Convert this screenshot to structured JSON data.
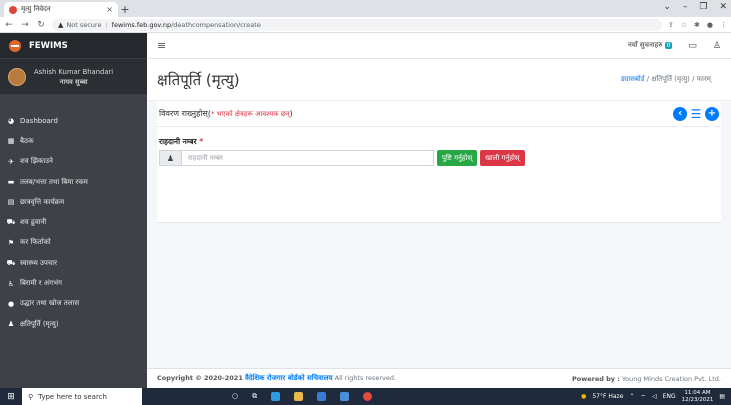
{
  "browser": {
    "tab_title": "मृत्यु निवेदन",
    "tab_close": "×",
    "new_tab": "+",
    "url_warning": "Not secure",
    "url_host": "fewims.feb.gov.np",
    "url_path": "/deathcompensation/create"
  },
  "sidebar": {
    "brand": "FEWIMS",
    "user_name": "Ashish Kumar Bhandari",
    "user_role": "नायव सुब्बा",
    "items": [
      {
        "icon": "dashboard-icon",
        "glyph": "◕",
        "label": "Dashboard"
      },
      {
        "icon": "calendar-icon",
        "glyph": "▦",
        "label": "बैठक"
      },
      {
        "icon": "plane-icon",
        "glyph": "✈",
        "label": "शव झिकाउने"
      },
      {
        "icon": "money-icon",
        "glyph": "▬",
        "label": "तलब/भत्ता तथा बिमा रकम"
      },
      {
        "icon": "document-icon",
        "glyph": "▤",
        "label": "छात्रवृत्ति कार्यक्रम"
      },
      {
        "icon": "truck-icon",
        "glyph": "⛟",
        "label": "शव ढुवानी"
      },
      {
        "icon": "flag-icon",
        "glyph": "⚑",
        "label": "कर फिर्ताको"
      },
      {
        "icon": "ambulance-icon",
        "glyph": "⛟",
        "label": "स्वास्थ्य उपचार"
      },
      {
        "icon": "wheelchair-icon",
        "glyph": "♿",
        "label": "बिरामी र अंगभंग"
      },
      {
        "icon": "location-icon",
        "glyph": "●",
        "label": "उद्धार तथा खोज तलास"
      },
      {
        "icon": "user-icon",
        "glyph": "♟",
        "label": "क्षतिपूर्ति (मृत्यु)"
      }
    ]
  },
  "topnav": {
    "notifications_label": "नयाँ सुचनाहरु",
    "notifications_count": "0"
  },
  "page": {
    "title": "क्षतिपूर्ति (मृत्यु)",
    "breadcrumb_home": "ड्यासबोर्ड",
    "breadcrumb_section": "क्षतिपूर्ति (मृत्यु)",
    "breadcrumb_current": "फारम्",
    "breadcrumb_sep": "/"
  },
  "form": {
    "heading": "विवरण राख्नुहोस्(",
    "required_note": "* भएको क्षेत्रहरू आवश्यक छन्",
    "heading_close": ")",
    "passport_label": "राहदानी नम्बर",
    "required_star": "*",
    "passport_placeholder": "राहदानी नम्बर",
    "passport_value": "",
    "confirm_button": "पुष्टि गर्नुहोस्",
    "clear_button": "खाली गर्नुहोस्"
  },
  "footer": {
    "copyright": "Copyright © 2020-2021",
    "org": "वैदेशिक रोजगार बोर्डको सचिवालय",
    "rights": "All rights reserved.",
    "powered_label": "Powered by :",
    "powered_by": "Young Minds Creation Pvt. Ltd."
  },
  "taskbar": {
    "search_placeholder": "Type here to search",
    "weather": "57°F Haze",
    "lang": "ENG",
    "time": "11:04 AM",
    "date": "12/23/2021"
  },
  "colors": {
    "sidebar": "#3e4147",
    "primary": "#007bff",
    "success": "#28a745",
    "danger": "#dc3545"
  }
}
